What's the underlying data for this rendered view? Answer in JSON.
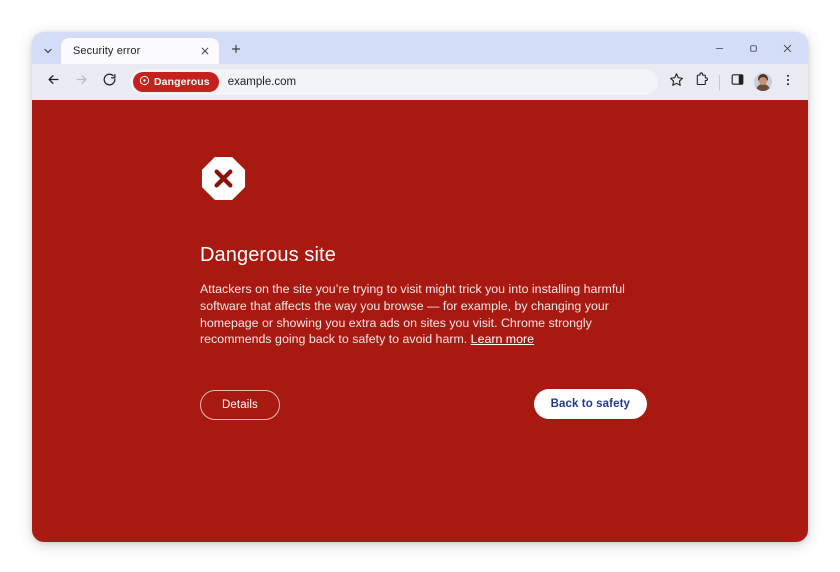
{
  "window": {
    "controls": {
      "minimize_label": "Minimize",
      "maximize_label": "Maximize",
      "close_label": "Close"
    }
  },
  "tabstrip": {
    "tab_search_label": "Search tabs",
    "new_tab_label": "New Tab",
    "tabs": [
      {
        "title": "Security error",
        "close_label": "Close tab"
      }
    ]
  },
  "toolbar": {
    "back_label": "Back",
    "forward_label": "Forward",
    "reload_label": "Reload",
    "omnibox": {
      "security_chip": "Dangerous",
      "url": "example.com"
    },
    "bookmark_label": "Bookmark this tab",
    "extensions_label": "Extensions",
    "side_panel_label": "Side panel",
    "profile_label": "Profile",
    "menu_label": "Customize and control Google Chrome"
  },
  "interstitial": {
    "heading": "Dangerous site",
    "body_part_1": "Attackers on the site you’re trying to visit might trick you into installing harmful software that affects the way you browse — for example, by changing your homepage or showing you extra ads on sites you visit. Chrome strongly recommends going back to safety to avoid harm. ",
    "learn_more": "Learn more",
    "details_button": "Details",
    "back_to_safety_button": "Back to safety"
  },
  "colors": {
    "page_background": "#a81a11",
    "tabstrip": "#d3ddf8",
    "toolbar": "#e9eaf2",
    "danger_chip": "#c5221f",
    "safety_button_text": "#1f3a8a"
  }
}
